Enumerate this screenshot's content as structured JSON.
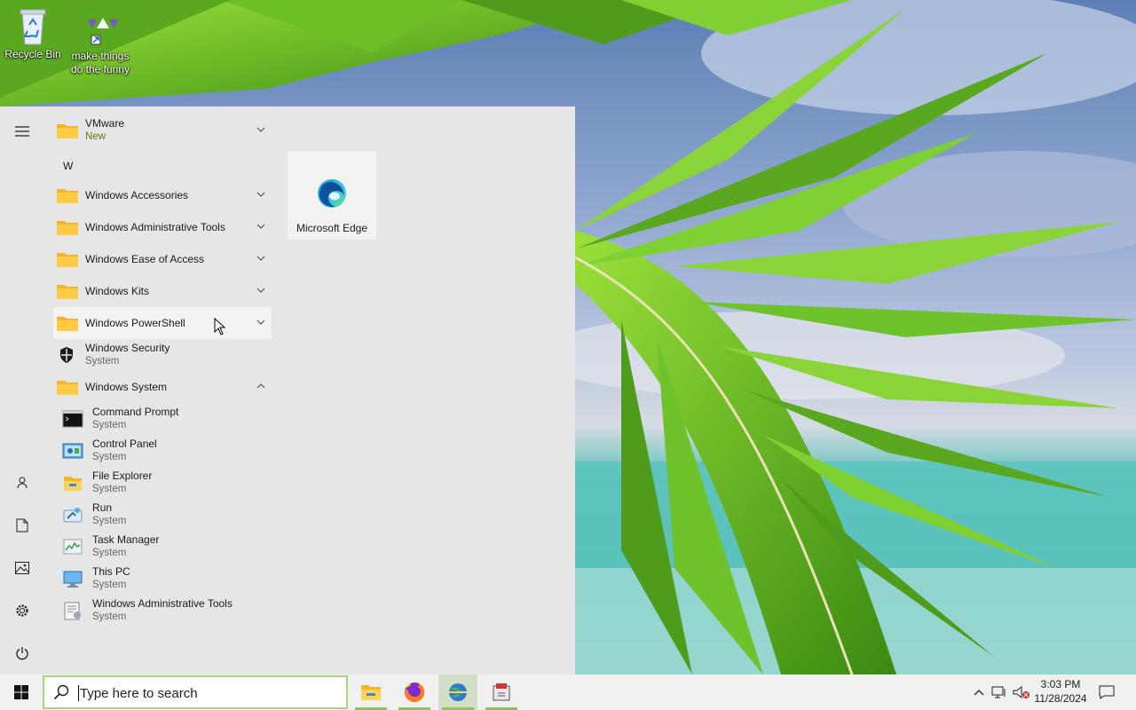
{
  "desktop": {
    "icons": [
      {
        "label": "Recycle Bin"
      },
      {
        "label": "make things do the funny"
      }
    ]
  },
  "start_menu": {
    "app_list": {
      "vmware": {
        "label": "VMware",
        "badge": "New"
      },
      "section_letter": "W",
      "folders": [
        {
          "label": "Windows Accessories"
        },
        {
          "label": "Windows Administrative Tools"
        },
        {
          "label": "Windows Ease of Access"
        },
        {
          "label": "Windows Kits"
        },
        {
          "label": "Windows PowerShell"
        }
      ],
      "windows_security": {
        "label": "Windows Security",
        "sub": "System"
      },
      "windows_system": {
        "label": "Windows System"
      },
      "system_items": [
        {
          "label": "Command Prompt",
          "sub": "System",
          "icon": "command-prompt-icon"
        },
        {
          "label": "Control Panel",
          "sub": "System",
          "icon": "control-panel-icon"
        },
        {
          "label": "File Explorer",
          "sub": "System",
          "icon": "file-explorer-icon"
        },
        {
          "label": "Run",
          "sub": "System",
          "icon": "run-icon"
        },
        {
          "label": "Task Manager",
          "sub": "System",
          "icon": "task-manager-icon"
        },
        {
          "label": "This PC",
          "sub": "System",
          "icon": "this-pc-icon"
        },
        {
          "label": "Windows Administrative Tools",
          "sub": "System",
          "icon": "admin-tools-icon"
        }
      ]
    },
    "tiles": [
      {
        "label": "Microsoft Edge",
        "icon": "edge-icon"
      }
    ],
    "left_rail": [
      "menu-icon",
      "user-icon",
      "documents-icon",
      "pictures-icon",
      "settings-icon",
      "power-icon"
    ]
  },
  "taskbar": {
    "search_placeholder": "Type here to search",
    "pinned": [
      "file-explorer-icon",
      "firefox-icon",
      "network-globe-icon",
      "archive-app-icon"
    ],
    "clock": {
      "time": "3:03 PM",
      "date": "11/28/2024"
    },
    "accent": "#8fc25b"
  }
}
